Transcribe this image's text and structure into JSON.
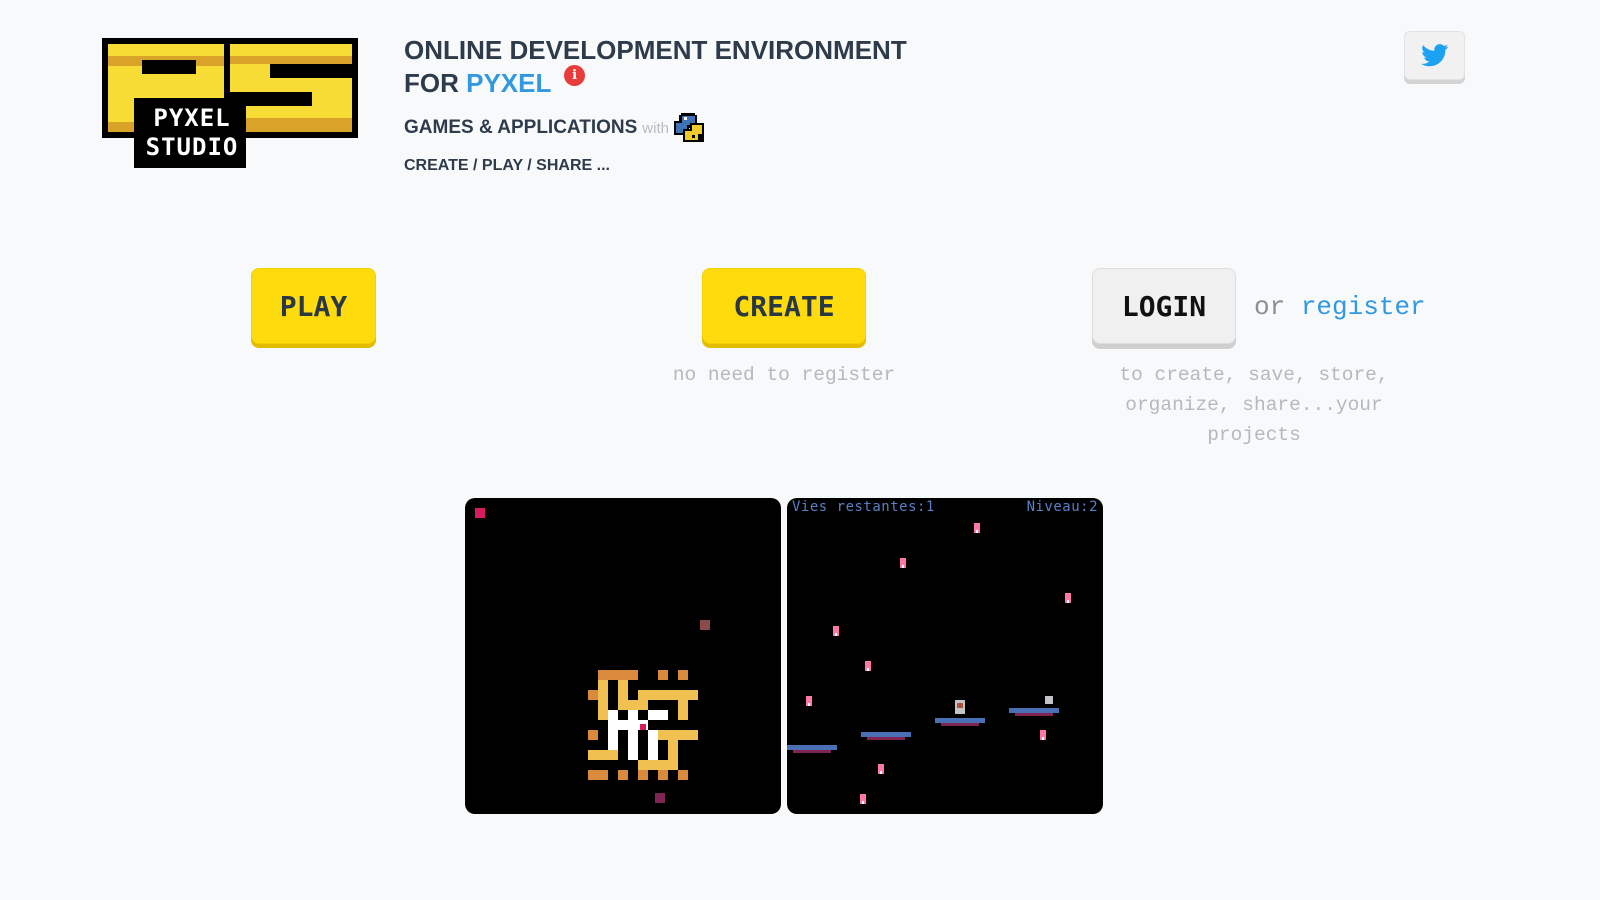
{
  "logo": {
    "letters": "PS",
    "line1": "PYXEL",
    "line2": "STUDIO",
    "colors": {
      "yellow": "#f6dc34",
      "shade": "#d9a32a",
      "outline": "#000000"
    }
  },
  "header": {
    "title_line1": "ONLINE DEVELOPMENT ENVIRONMENT",
    "title_for": "FOR",
    "title_pyxel": "PYXEL",
    "info_glyph": "i",
    "subtitle": "GAMES & APPLICATIONS",
    "with": "with",
    "python_icon": "python-logo-icon",
    "tagline": "CREATE / PLAY / SHARE ..."
  },
  "twitter": {
    "icon": "twitter-bird-icon",
    "color": "#1da1f2"
  },
  "actions": {
    "play": "PLAY",
    "create": "CREATE",
    "create_note": "no need to register",
    "login": "LOGIN",
    "or": "or",
    "register": "register",
    "login_note": "to create, save, store, organize, share...your projects"
  },
  "games": {
    "maze": {
      "name": "maze-game-thumbnail"
    },
    "platform": {
      "name": "platform-game-thumbnail",
      "hud_left": "Vies restantes:1",
      "hud_right": "Niveau:2"
    }
  },
  "colors": {
    "button_yellow": "#fddb0d",
    "link_blue": "#3299e0",
    "text_dark": "#2d3b4a",
    "muted": "#b5b9be"
  }
}
